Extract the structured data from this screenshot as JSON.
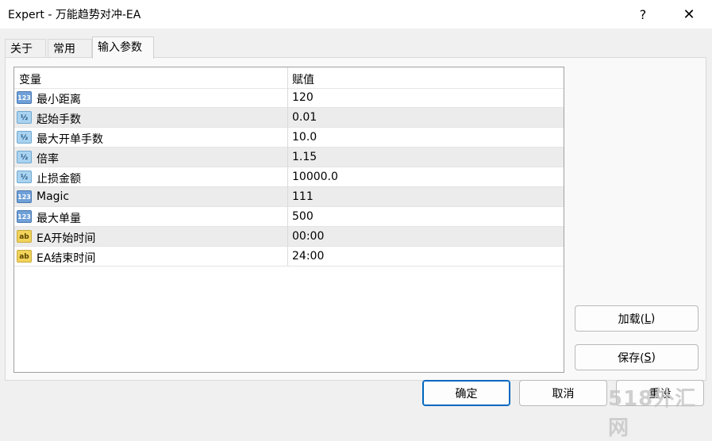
{
  "window": {
    "title": "Expert - 万能趋势对冲-EA",
    "help_label": "?",
    "close_label": "✕"
  },
  "tabs": [
    {
      "label": "关于"
    },
    {
      "label": "常用"
    },
    {
      "label": "输入参数"
    }
  ],
  "grid": {
    "header": {
      "name": "变量",
      "value": "赋值"
    },
    "rows": [
      {
        "icon": "int-type-icon",
        "icon_text": "123",
        "name": "最小距离",
        "value": "120"
      },
      {
        "icon": "double-type-icon",
        "icon_text": "½",
        "name": "起始手数",
        "value": "0.01"
      },
      {
        "icon": "double-type-icon",
        "icon_text": "½",
        "name": "最大开单手数",
        "value": "10.0"
      },
      {
        "icon": "double-type-icon",
        "icon_text": "½",
        "name": "倍率",
        "value": "1.15"
      },
      {
        "icon": "double-type-icon",
        "icon_text": "½",
        "name": "止损金额",
        "value": "10000.0"
      },
      {
        "icon": "int-type-icon",
        "icon_text": "123",
        "name": "Magic",
        "value": "111"
      },
      {
        "icon": "int-type-icon",
        "icon_text": "123",
        "name": "最大单量",
        "value": "500"
      },
      {
        "icon": "string-type-icon",
        "icon_text": "ab",
        "name": "EA开始时间",
        "value": "00:00"
      },
      {
        "icon": "string-type-icon",
        "icon_text": "ab",
        "name": "EA结束时间",
        "value": "24:00"
      }
    ]
  },
  "buttons": {
    "load": {
      "label": "加载(",
      "key": "L",
      "suffix": ")"
    },
    "save": {
      "label": "保存(",
      "key": "S",
      "suffix": ")"
    },
    "ok": {
      "label": "确定"
    },
    "cancel": {
      "label": "取消"
    },
    "reset": {
      "label": "重设"
    }
  },
  "watermark": "518外汇网"
}
